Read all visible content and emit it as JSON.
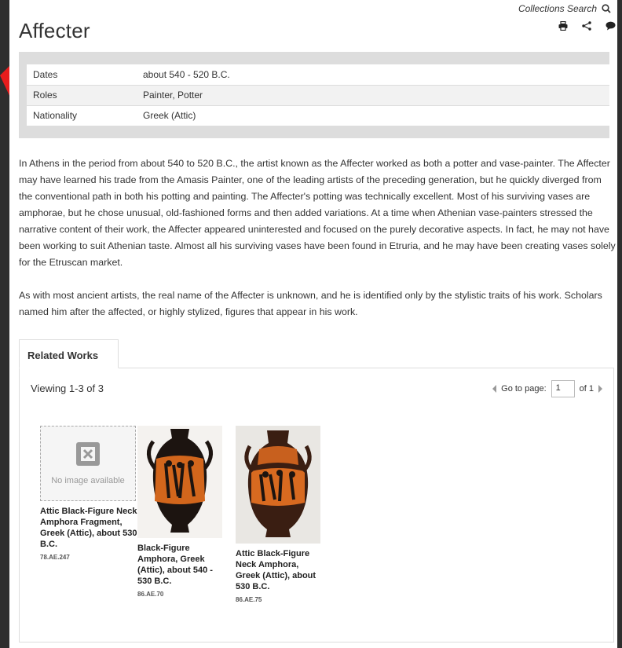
{
  "header": {
    "collections_search": "Collections Search",
    "title": "Affecter"
  },
  "facts": [
    {
      "label": "Dates",
      "value": "about 540 - 520 B.C."
    },
    {
      "label": "Roles",
      "value": "Painter, Potter"
    },
    {
      "label": "Nationality",
      "value": "Greek (Attic)"
    }
  ],
  "bio": {
    "p1": "In Athens in the period from about 540 to 520 B.C., the artist known as the Affecter worked as both a potter and vase-painter. The Affecter may have learned his trade from the Amasis Painter, one of the leading artists of the preceding generation, but he quickly diverged from the conventional path in both his potting and painting. The Affecter's potting was technically excellent. Most of his surviving vases are amphorae, but he chose unusual, old-fashioned forms and then added variations. At a time when Athenian vase-painters stressed the narrative content of their work, the Affecter appeared uninterested and focused on the purely decorative aspects. In fact, he may not have been working to suit Athenian taste. Almost all his surviving vases have been found in Etruria, and he may have been creating vases solely for the Etruscan market.",
    "p2": "As with most ancient artists, the real name of the Affecter is unknown, and he is identified only by the stylistic traits of his work. Scholars named him after the affected, or highly stylized, figures that appear in his work."
  },
  "related": {
    "tab_label": "Related Works",
    "viewing": "Viewing 1-3 of 3",
    "go_to_page": "Go to page:",
    "page_value": "1",
    "of_pages": "of 1",
    "no_image_text": "No image available",
    "items": [
      {
        "title": "Attic Black-Figure Neck Amphora Fragment, Greek (Attic), about 530 B.C.",
        "accession": "78.AE.247"
      },
      {
        "title": "Black-Figure Amphora, Greek (Attic), about 540 - 530 B.C.",
        "accession": "86.AE.70"
      },
      {
        "title": "Attic Black-Figure Neck Amphora, Greek (Attic), about 530 B.C.",
        "accession": "86.AE.75"
      }
    ]
  },
  "colors": {
    "accent_red": "#e81c1c",
    "facts_bg": "#dddddd",
    "vase_orange": "#d2661c",
    "vase_black": "#1c1410"
  },
  "icons": [
    "search-icon",
    "print-icon",
    "share-icon",
    "comment-icon",
    "placeholder-image-icon",
    "prev-page-icon",
    "next-page-icon"
  ]
}
